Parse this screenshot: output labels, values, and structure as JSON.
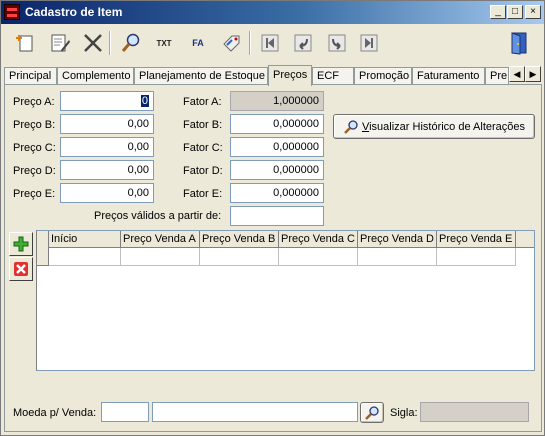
{
  "window": {
    "title": "Cadastro de Item",
    "controls": {
      "minimize": "_",
      "maximize": "□",
      "close": "×"
    }
  },
  "toolbar": {
    "items": [
      {
        "name": "new-icon"
      },
      {
        "name": "edit-icon"
      },
      {
        "name": "delete-icon"
      },
      {
        "name": "search-icon"
      },
      {
        "name": "txt-icon",
        "text": "TXT"
      },
      {
        "name": "fa-icon",
        "text": "FA"
      },
      {
        "name": "tag-icon"
      },
      {
        "name": "first-record-icon"
      },
      {
        "name": "previous-record-icon"
      },
      {
        "name": "next-record-icon"
      },
      {
        "name": "last-record-icon"
      },
      {
        "name": "exit-door-icon"
      }
    ]
  },
  "tabs": [
    {
      "label": "Principal"
    },
    {
      "label": "Complemento"
    },
    {
      "label": "Planejamento de Estoque"
    },
    {
      "label": "Preços",
      "active": true
    },
    {
      "label": "ECF"
    },
    {
      "label": "Promoção"
    },
    {
      "label": "Faturamento"
    },
    {
      "label": "Pre"
    }
  ],
  "tab_scroll": {
    "left": "◀",
    "right": "▶"
  },
  "prices": {
    "a_label": "Preço A:",
    "a_value": "0",
    "b_label": "Preço B:",
    "b_value": "0,00",
    "c_label": "Preço C:",
    "c_value": "0,00",
    "d_label": "Preço D:",
    "d_value": "0,00",
    "e_label": "Preço E:",
    "e_value": "0,00"
  },
  "factors": {
    "a_label": "Fator A:",
    "a_value": "1,000000",
    "b_label": "Fator B:",
    "b_value": "0,000000",
    "c_label": "Fator C:",
    "c_value": "0,000000",
    "d_label": "Fator D:",
    "d_value": "0,000000",
    "e_label": "Fator E:",
    "e_value": "0,000000"
  },
  "valid_from": {
    "label": "Preços válidos a partir de:",
    "value": ""
  },
  "history_button": {
    "label_pre": "",
    "label_underlined": "V",
    "label_rest": "isualizar Histórico de Alterações"
  },
  "grid": {
    "columns": [
      "Início",
      "Preço Venda A",
      "Preço Venda B",
      "Preço Venda C",
      "Preço Venda D",
      "Preço Venda E"
    ]
  },
  "bottom": {
    "currency_label": "Moeda p/ Venda:",
    "currency_code": "",
    "currency_name": "",
    "symbol_label": "Sigla:",
    "symbol_value": ""
  }
}
